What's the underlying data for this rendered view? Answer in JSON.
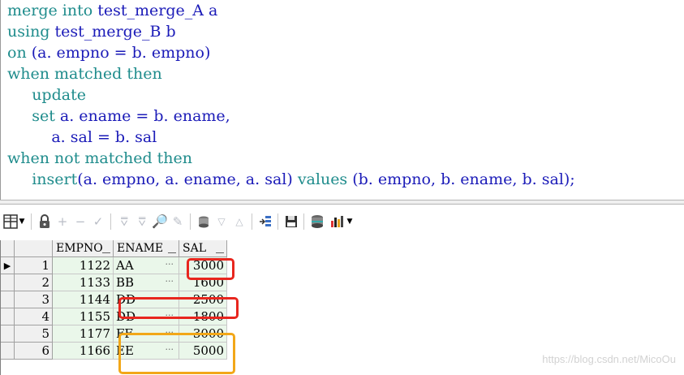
{
  "sql": [
    {
      "parts": [
        {
          "t": "merge into ",
          "c": "kw"
        },
        {
          "t": "test_merge_A a",
          "c": "tx"
        }
      ]
    },
    {
      "parts": [
        {
          "t": "using ",
          "c": "kw"
        },
        {
          "t": "test_merge_B b",
          "c": "tx"
        }
      ]
    },
    {
      "parts": [
        {
          "t": "on ",
          "c": "kw"
        },
        {
          "t": "(a. empno = b. empno)",
          "c": "tx"
        }
      ]
    },
    {
      "parts": [
        {
          "t": "when matched then",
          "c": "kw"
        }
      ]
    },
    {
      "parts": [
        {
          "t": "     update",
          "c": "kw"
        }
      ]
    },
    {
      "parts": [
        {
          "t": "     set ",
          "c": "kw"
        },
        {
          "t": "a. ename = b. ename,",
          "c": "tx"
        }
      ]
    },
    {
      "parts": [
        {
          "t": "         a. sal = b. sal",
          "c": "tx"
        }
      ]
    },
    {
      "parts": [
        {
          "t": "when not matched then",
          "c": "kw"
        }
      ]
    },
    {
      "parts": [
        {
          "t": "     insert",
          "c": "kw"
        },
        {
          "t": "(a. empno, a. ename, a. sal) ",
          "c": "tx"
        },
        {
          "t": "values ",
          "c": "kw"
        },
        {
          "t": "(b. empno, b. ename, b. sal);",
          "c": "tx"
        }
      ]
    }
  ],
  "toolbar": {
    "icons": [
      "grid-icon",
      "dropdown-arrow-icon",
      "lock-icon",
      "add-record-icon",
      "delete-record-icon",
      "post-record-icon",
      "filter-icon",
      "clear-filter-icon",
      "find-icon",
      "clear-icon",
      "query-by-example-icon",
      "previous-record-icon",
      "next-record-icon",
      "export-icon",
      "save-icon",
      "database-icon",
      "chart-icon",
      "chart-dropdown-icon"
    ]
  },
  "grid": {
    "columns": [
      "EMPNO",
      "ENAME",
      "SAL"
    ],
    "rows": [
      {
        "rn": "1",
        "empno": "1122",
        "ename": "AA",
        "sal": "3000",
        "current": true
      },
      {
        "rn": "2",
        "empno": "1133",
        "ename": "BB",
        "sal": "1600",
        "current": false
      },
      {
        "rn": "3",
        "empno": "1144",
        "ename": "DD",
        "sal": "2500",
        "current": false
      },
      {
        "rn": "4",
        "empno": "1155",
        "ename": "DD",
        "sal": "1800",
        "current": false
      },
      {
        "rn": "5",
        "empno": "1177",
        "ename": "FF",
        "sal": "3000",
        "current": false
      },
      {
        "rn": "6",
        "empno": "1166",
        "ename": "EE",
        "sal": "5000",
        "current": false
      }
    ],
    "ellipsis": "···",
    "current_marker": "▶"
  },
  "colors": {
    "keyword": "#1f8c8c",
    "text": "#1b1bb8",
    "highlight_red": "#e8261e",
    "highlight_orange": "#f2a718",
    "row_bg": "#eaf7ea"
  },
  "watermark": "https://blog.csdn.net/MicoOu"
}
